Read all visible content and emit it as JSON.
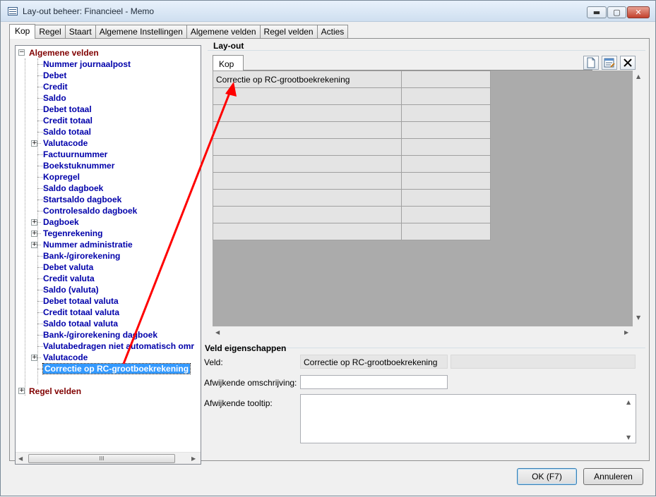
{
  "window": {
    "title": "Lay-out beheer: Financieel - Memo",
    "min_glyph": "▬",
    "max_glyph": "▢",
    "close_glyph": "✕"
  },
  "tabs": [
    {
      "label": "Kop",
      "active": true
    },
    {
      "label": "Regel"
    },
    {
      "label": "Staart"
    },
    {
      "label": "Algemene Instellingen"
    },
    {
      "label": "Algemene velden"
    },
    {
      "label": "Regel velden"
    },
    {
      "label": "Acties"
    }
  ],
  "tree": {
    "root1": "Algemene velden",
    "root2": "Regel velden",
    "children": [
      {
        "label": "Nummer journaalpost"
      },
      {
        "label": "Debet"
      },
      {
        "label": "Credit"
      },
      {
        "label": "Saldo"
      },
      {
        "label": "Debet totaal"
      },
      {
        "label": "Credit totaal"
      },
      {
        "label": "Saldo totaal"
      },
      {
        "label": "Valutacode",
        "expandable": true
      },
      {
        "label": "Factuurnummer"
      },
      {
        "label": "Boekstuknummer"
      },
      {
        "label": "Kopregel"
      },
      {
        "label": "Saldo dagboek"
      },
      {
        "label": "Startsaldo dagboek"
      },
      {
        "label": "Controlesaldo dagboek"
      },
      {
        "label": "Dagboek",
        "expandable": true
      },
      {
        "label": "Tegenrekening",
        "expandable": true
      },
      {
        "label": "Nummer administratie",
        "expandable": true
      },
      {
        "label": "Bank-/girorekening"
      },
      {
        "label": "Debet valuta"
      },
      {
        "label": "Credit valuta"
      },
      {
        "label": "Saldo (valuta)"
      },
      {
        "label": "Debet totaal valuta"
      },
      {
        "label": "Credit totaal valuta"
      },
      {
        "label": "Saldo totaal valuta"
      },
      {
        "label": "Bank-/girorekening dagboek"
      },
      {
        "label": "Valutabedragen niet automatisch omr"
      },
      {
        "label": "Valutacode",
        "expandable": true
      },
      {
        "label": "Correctie op RC-grootboekrekening",
        "selected": true
      }
    ]
  },
  "layout": {
    "group_title": "Lay-out",
    "inner_tab": "Kop",
    "grid_first_cell": "Correctie op RC-grootboekrekening",
    "grid_rows": 10
  },
  "properties": {
    "group_title": "Veld eigenschappen",
    "veld_label": "Veld:",
    "veld_value": "Correctie op RC-grootboekrekening",
    "omschrijving_label": "Afwijkende omschrijving:",
    "omschrijving_value": "",
    "tooltip_label": "Afwijkende tooltip:",
    "tooltip_value": ""
  },
  "buttons": {
    "ok": "OK (F7)",
    "cancel": "Annuleren"
  },
  "scroll_glyphs": {
    "left": "◀",
    "right": "▶",
    "up": "▲",
    "down": "▼",
    "grip": "III"
  },
  "colors": {
    "root_node": "#800000",
    "child_node": "#0000aa",
    "selection": "#3399ff",
    "annotation_arrow": "#ff0000"
  }
}
